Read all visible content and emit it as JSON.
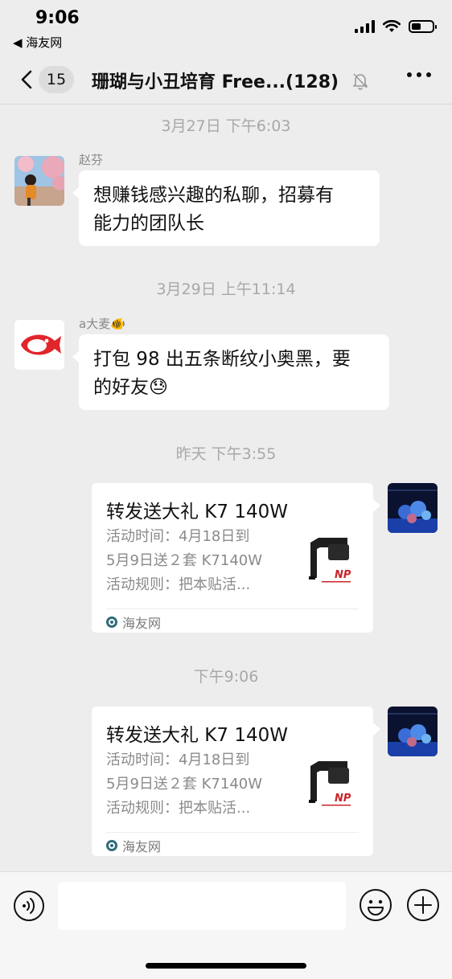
{
  "status": {
    "time": "9:06",
    "back_app": "◀ 海友网",
    "battery_level": 0.45
  },
  "nav": {
    "unread_count": "15",
    "title": "珊瑚与小丑培育 Free...(128)"
  },
  "messages": [
    {
      "type": "timestamp",
      "text": "3月27日 下午6:03"
    },
    {
      "type": "text",
      "sender": "赵芬",
      "lines": [
        "想赚钱感兴趣的私聊，招募有",
        "能力的团队长"
      ]
    },
    {
      "type": "timestamp",
      "text": "3月29日 上午11:14"
    },
    {
      "type": "text",
      "sender": "a大麦🐠",
      "lines": [
        "打包 98 出五条断纹小奥黑，要",
        "的好友😓"
      ]
    },
    {
      "type": "timestamp",
      "text": "昨天 下午3:55"
    },
    {
      "type": "link_card",
      "title": "转发送大礼 K7 140W",
      "desc_lines": [
        "活动时间：4月18日到",
        "5月9日送２套 K7140W",
        "活动规则：把本贴活..."
      ],
      "source": "海友网",
      "thumb_badge": "NP"
    },
    {
      "type": "timestamp",
      "text": "下午9:06"
    },
    {
      "type": "link_card",
      "title": "转发送大礼 K7 140W",
      "desc_lines": [
        "活动时间：4月18日到",
        "5月9日送２套 K7140W",
        "活动规则：把本贴活..."
      ],
      "source": "海友网",
      "thumb_badge": "NP"
    }
  ],
  "colors": {
    "background": "#ededed",
    "bubble": "#ffffff",
    "timestamp": "#a8a8a8",
    "fish_red": "#e0262b",
    "aquarium_blue": "#1a3fa8"
  },
  "icons": {
    "back": "chevron-left-icon",
    "mute": "bell-off-icon",
    "more": "more-horizontal-icon",
    "voice": "voice-icon",
    "emoji": "smile-icon",
    "plus": "plus-circle-icon"
  }
}
